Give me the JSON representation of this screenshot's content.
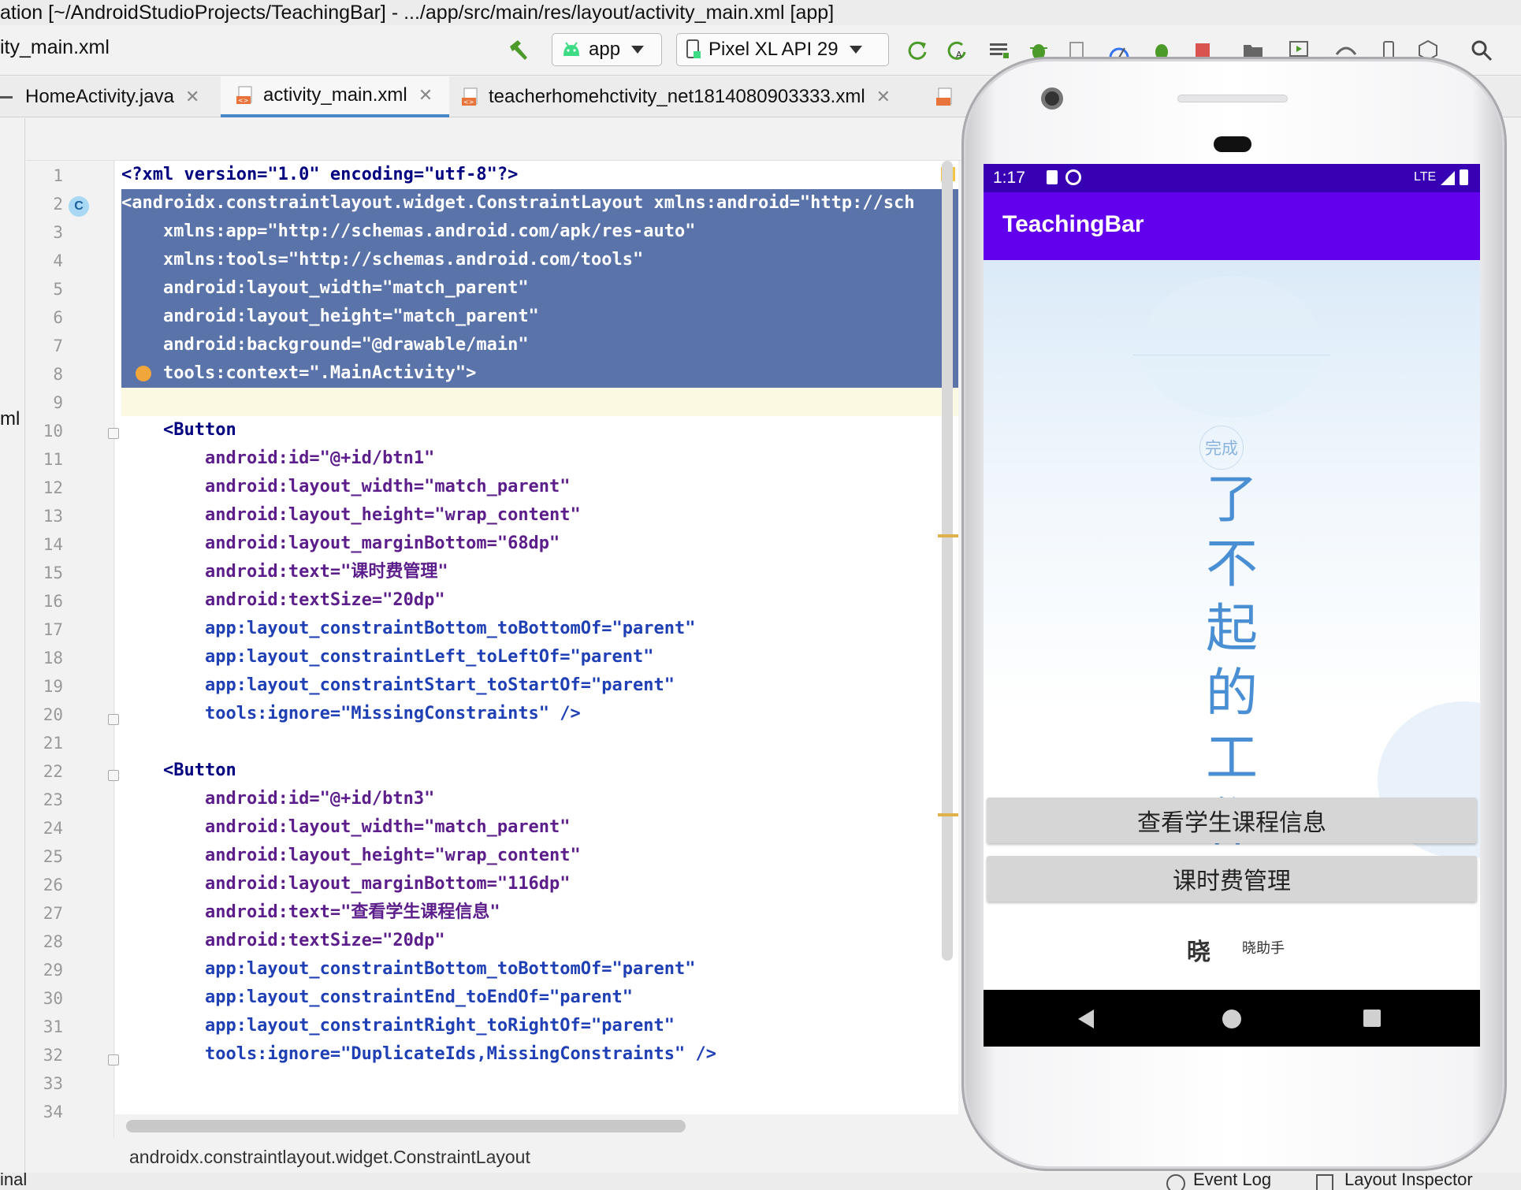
{
  "window": {
    "title": "ation [~/AndroidStudioProjects/TeachingBar] - .../app/src/main/res/layout/activity_main.xml [app]"
  },
  "toolbar": {
    "current_file": "ity_main.xml",
    "run_config": "app",
    "device": "Pixel XL API 29",
    "icons": [
      "hammer-icon",
      "rerun-icon",
      "apply-changes-icon",
      "logcat-icon",
      "debug-icon",
      "attach-icon",
      "profile-icon",
      "coverage-icon",
      "stop-icon",
      "project-icon",
      "avd-manager-icon",
      "sdk-manager-icon",
      "device-icon",
      "build-variant-icon",
      "search-icon"
    ]
  },
  "tabs": [
    {
      "label": "HomeActivity.java",
      "active": false
    },
    {
      "label": "activity_main.xml",
      "active": true
    },
    {
      "label": "teacherhomehctivity_net1814080903333.xml",
      "active": false
    }
  ],
  "left_strip_label": "ml",
  "editor": {
    "line_numbers": [
      "1",
      "2",
      "3",
      "4",
      "5",
      "6",
      "7",
      "8",
      "9",
      "10",
      "11",
      "12",
      "13",
      "14",
      "15",
      "16",
      "17",
      "18",
      "19",
      "20",
      "21",
      "22",
      "23",
      "24",
      "25",
      "26",
      "27",
      "28",
      "29",
      "30",
      "31",
      "32",
      "33",
      "34"
    ],
    "lines": [
      "<?xml version=\"1.0\" encoding=\"utf-8\"?>",
      "<androidx.constraintlayout.widget.ConstraintLayout xmlns:android=\"http://sch",
      "    xmlns:app=\"http://schemas.android.com/apk/res-auto\"",
      "    xmlns:tools=\"http://schemas.android.com/tools\"",
      "    android:layout_width=\"match_parent\"",
      "    android:layout_height=\"match_parent\"",
      "    android:background=\"@drawable/main\"",
      "    tools:context=\".MainActivity\">",
      "",
      "    <Button",
      "        android:id=\"@+id/btn1\"",
      "        android:layout_width=\"match_parent\"",
      "        android:layout_height=\"wrap_content\"",
      "        android:layout_marginBottom=\"68dp\"",
      "        android:text=\"课时费管理\"",
      "        android:textSize=\"20dp\"",
      "        app:layout_constraintBottom_toBottomOf=\"parent\"",
      "        app:layout_constraintLeft_toLeftOf=\"parent\"",
      "        app:layout_constraintStart_toStartOf=\"parent\"",
      "        tools:ignore=\"MissingConstraints\" />",
      "",
      "    <Button",
      "        android:id=\"@+id/btn3\"",
      "        android:layout_width=\"match_parent\"",
      "        android:layout_height=\"wrap_content\"",
      "        android:layout_marginBottom=\"116dp\"",
      "        android:text=\"查看学生课程信息\"",
      "        android:textSize=\"20dp\"",
      "        app:layout_constraintBottom_toBottomOf=\"parent\"",
      "        app:layout_constraintEnd_toEndOf=\"parent\"",
      "        app:layout_constraintRight_toRightOf=\"parent\"",
      "        tools:ignore=\"DuplicateIds,MissingConstraints\" />",
      "",
      ""
    ],
    "breadcrumb": "androidx.constraintlayout.widget.ConstraintLayout"
  },
  "bottom_bar": {
    "left": "inal",
    "event_log": "Event Log",
    "layout_inspector": "Layout Inspector"
  },
  "phone": {
    "status_time": "1:17",
    "network": "LTE",
    "app_title": "TeachingBar",
    "badge": "完成",
    "vertical_text": [
      "了",
      "不",
      "起",
      "的",
      "工",
      "作"
    ],
    "button_view_courses": "查看学生课程信息",
    "button_fee_management": "课时费管理",
    "logo_mark": "晓",
    "logo_text": "晓助手",
    "nav_icons": [
      "back-icon",
      "home-icon",
      "recents-icon"
    ]
  },
  "colors": {
    "status_bar": "#3700b3",
    "app_bar": "#6200ee",
    "selection": "#5a73a8",
    "xml_value": "#067d17",
    "xml_attr": "#5c1e8a"
  }
}
